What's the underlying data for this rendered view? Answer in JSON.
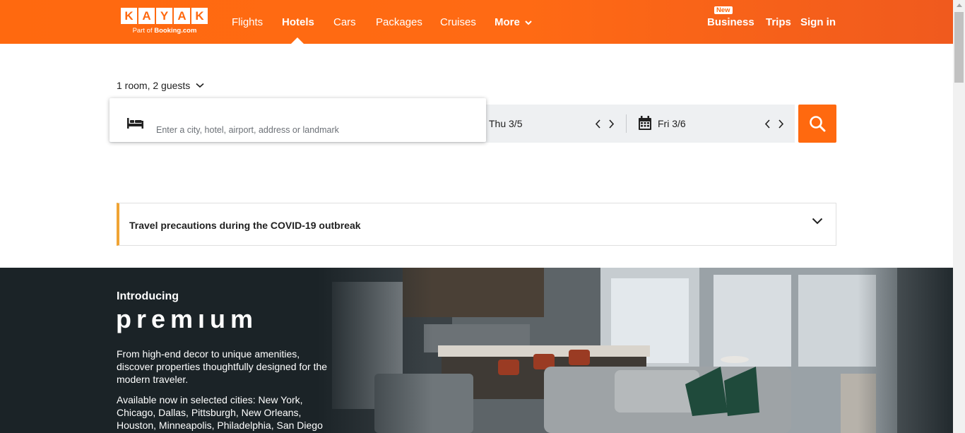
{
  "header": {
    "logo_letters": [
      "K",
      "A",
      "Y",
      "A",
      "K"
    ],
    "logo_sub_prefix": "Part of ",
    "logo_sub_brand": "Booking.com",
    "nav": [
      {
        "label": "Flights"
      },
      {
        "label": "Hotels",
        "active": true
      },
      {
        "label": "Cars"
      },
      {
        "label": "Packages"
      },
      {
        "label": "Cruises"
      },
      {
        "label": "More"
      }
    ],
    "new_badge": "New",
    "business": "Business",
    "trips": "Trips",
    "sign_in": "Sign in"
  },
  "search": {
    "guests": "1 room, 2 guests",
    "destination_placeholder": "Enter a city, hotel, airport, address or landmark",
    "checkin": "Thu 3/5",
    "checkout": "Fri 3/6"
  },
  "covid": {
    "title": "Travel precautions during the COVID-19 outbreak"
  },
  "hero": {
    "intro": "Introducing",
    "premium": "premıum",
    "p1": "From high-end decor to unique amenities, discover properties thoughtfully designed for the modern traveler.",
    "p2": "Available now in selected cities: New York, Chicago, Dallas, Pittsburgh, New Orleans, Houston, Minneapolis, Philadelphia, San Diego"
  },
  "colors": {
    "brand": "#ff690f",
    "covid_accent": "#f0a434",
    "hero_bg": "#1b2327"
  }
}
